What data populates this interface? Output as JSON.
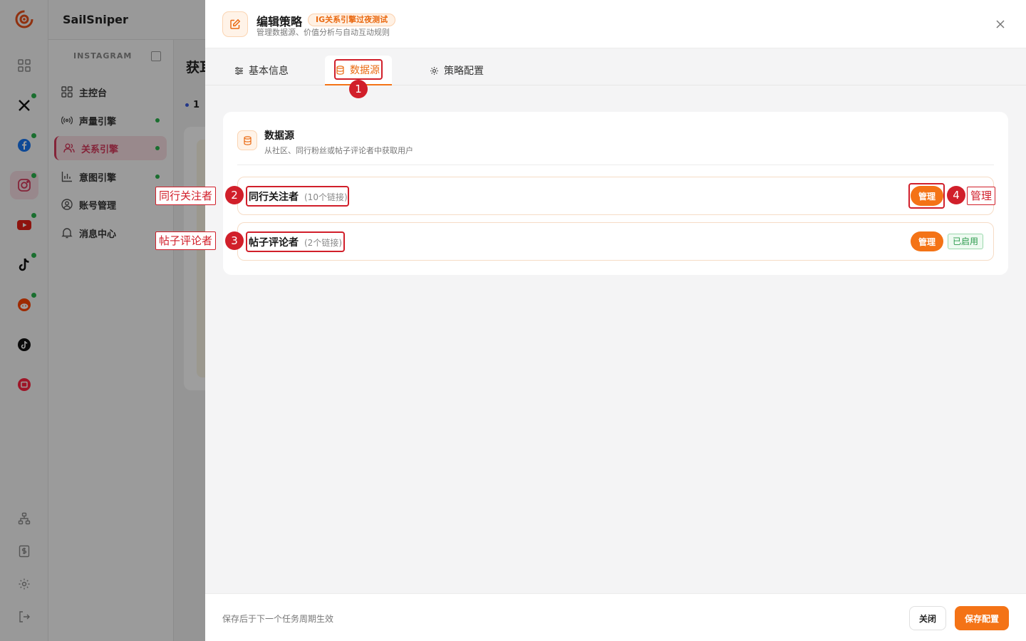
{
  "app": {
    "brand": "SailSniper",
    "section_label": "INSTAGRAM",
    "nav": [
      {
        "label": "主控台",
        "icon": "dashboard-icon",
        "dot": false
      },
      {
        "label": "声量引擎",
        "icon": "broadcast-icon",
        "dot": true
      },
      {
        "label": "关系引擎",
        "icon": "users-icon",
        "dot": true,
        "active": true
      },
      {
        "label": "意图引擎",
        "icon": "bar-chart-icon",
        "dot": true
      },
      {
        "label": "账号管理",
        "icon": "user-circle-icon",
        "dot": false
      },
      {
        "label": "消息中心",
        "icon": "bell-icon",
        "dot": false
      }
    ],
    "rail_icons": [
      "grid-icon",
      "x-icon",
      "facebook-icon",
      "instagram-icon",
      "youtube-icon",
      "tiktok-icon",
      "reddit-icon",
      "tiktok-alt-icon",
      "xiaohongshu-icon",
      "org-icon",
      "billing-icon",
      "settings-icon",
      "logout-icon"
    ],
    "main_title_partial": "获耳",
    "main_step_partial": "1"
  },
  "drawer": {
    "title": "编辑策略",
    "badge": "IG关系引擎过夜测试",
    "subtitle": "管理数据源、价值分析与自动互动规则",
    "tabs": [
      {
        "label": "基本信息",
        "icon": "sliders-icon"
      },
      {
        "label": "数据源",
        "icon": "database-icon",
        "active": true
      },
      {
        "label": "策略配置",
        "icon": "gear-icon"
      }
    ],
    "panel": {
      "title": "数据源",
      "subtitle": "从社区、同行粉丝或帖子评论者中获取用户",
      "rows": [
        {
          "name": "同行关注者",
          "count": "(10个链接)",
          "manage": "管理",
          "status": ""
        },
        {
          "name": "帖子评论者",
          "count": "(2个链接)",
          "manage": "管理",
          "status": "已启用"
        }
      ]
    },
    "footer": {
      "note": "保存后于下一个任务周期生效",
      "close": "关闭",
      "save": "保存配置"
    }
  },
  "annotations": {
    "marks": [
      "1",
      "2",
      "3",
      "4"
    ],
    "labels": [
      "同行关注者",
      "帖子评论者",
      "管理"
    ]
  },
  "colors": {
    "accent": "#f47316",
    "instagram_active": "#d63a5c",
    "annotation": "#d11f2a",
    "enabled_green": "#2b9a4c"
  }
}
